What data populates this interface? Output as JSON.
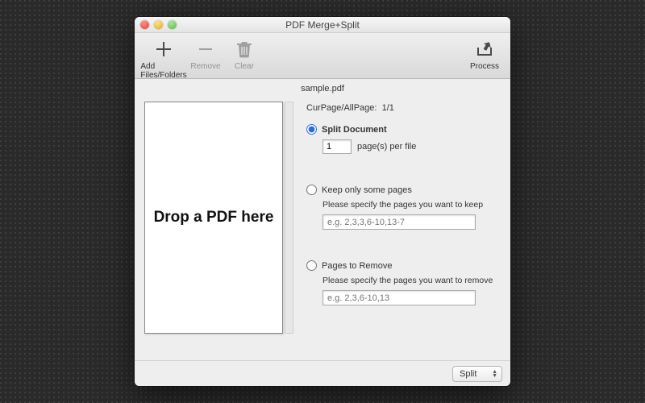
{
  "window": {
    "title": "PDF Merge+Split"
  },
  "toolbar": {
    "add": {
      "label": "Add Files/Folders"
    },
    "remove": {
      "label": "Remove"
    },
    "clear": {
      "label": "Clear"
    },
    "process": {
      "label": "Process"
    }
  },
  "preview": {
    "filename": "sample.pdf",
    "dropLabel": "Drop a PDF here"
  },
  "options": {
    "curpageLabel": "CurPage/AllPage:",
    "curpageValue": "1/1",
    "split": {
      "label": "Split  Document",
      "pagesValue": "1",
      "suffix": "page(s) per file",
      "selected": true
    },
    "keep": {
      "label": "Keep only some pages",
      "hint": "Please specify the pages you want to keep",
      "placeholder": "e.g. 2,3,3,6-10,13-7",
      "selected": false
    },
    "remove": {
      "label": "Pages to Remove",
      "hint": "Please specify the pages you want to remove",
      "placeholder": "e.g. 2,3,6-10,13",
      "selected": false
    }
  },
  "footer": {
    "modeSelected": "Split"
  }
}
